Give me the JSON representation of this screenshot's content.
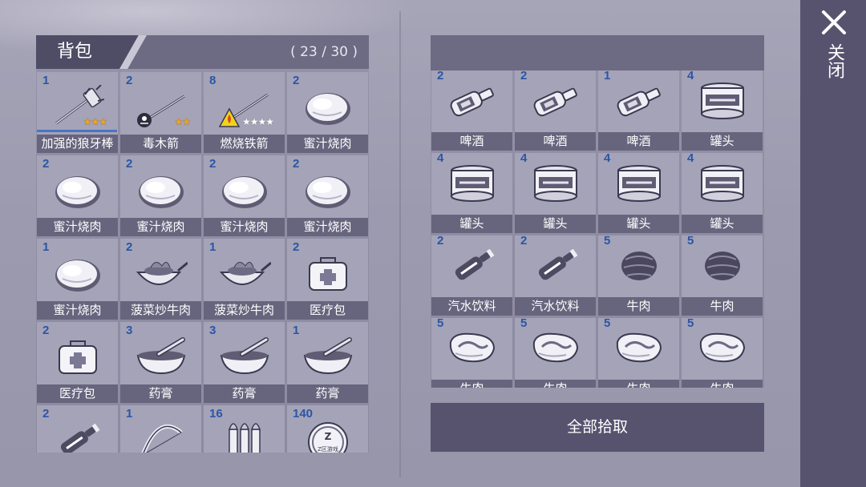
{
  "bag": {
    "title": "背包",
    "count": "( 23 / 30 )",
    "items": [
      {
        "qty": "1",
        "label": "加强的狼牙棒",
        "icon": "mace-icon",
        "stars": "★★★",
        "star_style": "gold",
        "bar": true
      },
      {
        "qty": "2",
        "label": "毒木箭",
        "icon": "poison-arrow-icon",
        "stars": "★★",
        "star_style": "gold"
      },
      {
        "qty": "8",
        "label": "燃烧铁箭",
        "icon": "fire-arrow-icon",
        "stars": "★★★★",
        "star_style": "grey"
      },
      {
        "qty": "2",
        "label": "蜜汁烧肉",
        "icon": "roast-meat-icon"
      },
      {
        "qty": "2",
        "label": "蜜汁烧肉",
        "icon": "roast-meat-icon"
      },
      {
        "qty": "2",
        "label": "蜜汁烧肉",
        "icon": "roast-meat-icon"
      },
      {
        "qty": "2",
        "label": "蜜汁烧肉",
        "icon": "roast-meat-icon"
      },
      {
        "qty": "2",
        "label": "蜜汁烧肉",
        "icon": "roast-meat-icon"
      },
      {
        "qty": "1",
        "label": "蜜汁烧肉",
        "icon": "roast-meat-icon"
      },
      {
        "qty": "2",
        "label": "菠菜炒牛肉",
        "icon": "wok-icon"
      },
      {
        "qty": "1",
        "label": "菠菜炒牛肉",
        "icon": "wok-icon"
      },
      {
        "qty": "2",
        "label": "医疗包",
        "icon": "medkit-icon"
      },
      {
        "qty": "2",
        "label": "医疗包",
        "icon": "medkit-icon"
      },
      {
        "qty": "3",
        "label": "药膏",
        "icon": "mortar-icon"
      },
      {
        "qty": "3",
        "label": "药膏",
        "icon": "mortar-icon"
      },
      {
        "qty": "1",
        "label": "药膏",
        "icon": "mortar-icon"
      },
      {
        "qty": "2",
        "label": "",
        "icon": "soda-bottle-icon"
      },
      {
        "qty": "1",
        "label": "",
        "icon": "bow-icon",
        "stars": "★★★★",
        "star_style": "grey"
      },
      {
        "qty": "16",
        "label": "",
        "icon": "bullets-icon",
        "stars": "★★★★★",
        "star_style": "gold"
      },
      {
        "qty": "140",
        "label": "",
        "icon": "coin-icon",
        "coin_text": "Z区游戏"
      }
    ]
  },
  "loot": {
    "items": [
      {
        "qty": "2",
        "label": "啤酒",
        "icon": "beer-bottle-icon"
      },
      {
        "qty": "2",
        "label": "啤酒",
        "icon": "beer-bottle-icon"
      },
      {
        "qty": "1",
        "label": "啤酒",
        "icon": "beer-bottle-icon"
      },
      {
        "qty": "4",
        "label": "罐头",
        "icon": "can-icon"
      },
      {
        "qty": "4",
        "label": "罐头",
        "icon": "can-icon"
      },
      {
        "qty": "4",
        "label": "罐头",
        "icon": "can-icon"
      },
      {
        "qty": "4",
        "label": "罐头",
        "icon": "can-icon"
      },
      {
        "qty": "4",
        "label": "罐头",
        "icon": "can-icon"
      },
      {
        "qty": "2",
        "label": "汽水饮料",
        "icon": "soda-bottle-icon"
      },
      {
        "qty": "2",
        "label": "汽水饮料",
        "icon": "soda-bottle-icon"
      },
      {
        "qty": "5",
        "label": "牛肉",
        "icon": "beef-icon"
      },
      {
        "qty": "5",
        "label": "牛肉",
        "icon": "beef-icon"
      },
      {
        "qty": "5",
        "label": "牛肉",
        "icon": "steak-icon"
      },
      {
        "qty": "5",
        "label": "牛肉",
        "icon": "steak-icon"
      },
      {
        "qty": "5",
        "label": "牛肉",
        "icon": "steak-icon"
      },
      {
        "qty": "5",
        "label": "牛肉",
        "icon": "steak-icon"
      }
    ]
  },
  "pickup_all_label": "全部拾取",
  "close_label": "关闭",
  "colors": {
    "qty_blue": "#2a56a6",
    "label_bg": "#67647d",
    "cell_bg": "#a5a3b7",
    "panel_dark": "#57536f"
  }
}
